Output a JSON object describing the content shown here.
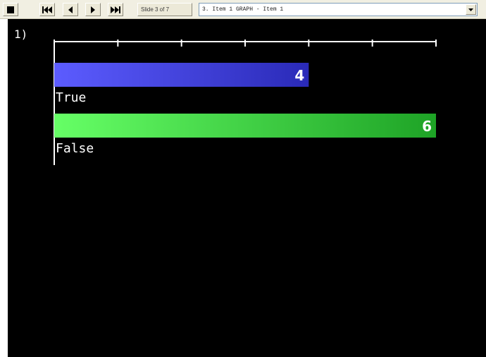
{
  "toolbar": {
    "buttons": [
      {
        "name": "stop-button",
        "icon": "stop-icon"
      },
      {
        "name": "first-slide-button",
        "icon": "skip-to-start-icon"
      },
      {
        "name": "previous-slide-button",
        "icon": "previous-icon"
      },
      {
        "name": "next-slide-button",
        "icon": "next-icon"
      },
      {
        "name": "last-slide-button",
        "icon": "skip-to-end-icon"
      }
    ],
    "slide_counter": "Slide 3 of 7",
    "slide_select": {
      "selected": "3. Item 1 GRAPH - Item 1",
      "icon": "chevron-down-icon"
    }
  },
  "slide": {
    "question_number": "1)"
  },
  "chart_data": {
    "type": "bar",
    "orientation": "horizontal",
    "categories": [
      "True",
      "False"
    ],
    "values": [
      4,
      6
    ],
    "colors": [
      "#4b4df0",
      "#3ed64a"
    ],
    "xlim": [
      0,
      6
    ],
    "ticks": 7,
    "data_labels": [
      "4",
      "6"
    ],
    "title": "",
    "xlabel": "",
    "ylabel": ""
  }
}
